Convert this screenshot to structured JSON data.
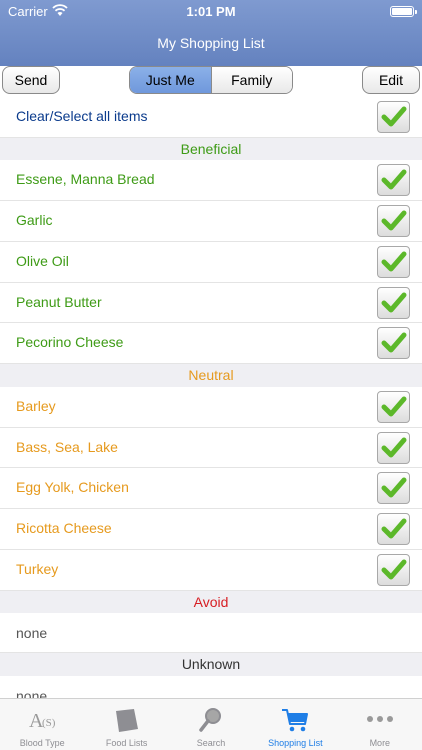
{
  "status": {
    "carrier": "Carrier",
    "time": "1:01 PM"
  },
  "nav": {
    "title": "My Shopping List"
  },
  "toolbar": {
    "send_label": "Send",
    "edit_label": "Edit",
    "seg_just_me": "Just Me",
    "seg_family": "Family"
  },
  "clear_row": {
    "label": "Clear/Select all items",
    "checked": true
  },
  "sections": {
    "beneficial": {
      "title": "Beneficial",
      "color": "#3e9b16",
      "items": [
        "Essene, Manna Bread",
        "Garlic",
        "Olive Oil",
        "Peanut Butter",
        "Pecorino Cheese"
      ]
    },
    "neutral": {
      "title": "Neutral",
      "color": "#e69a1e",
      "items": [
        "Barley",
        "Bass, Sea, Lake",
        "Egg Yolk, Chicken",
        "Ricotta Cheese",
        "Turkey"
      ]
    },
    "avoid": {
      "title": "Avoid",
      "color": "#d71e23",
      "empty_text": "none"
    },
    "unknown": {
      "title": "Unknown",
      "empty_text": "none"
    }
  },
  "tabs": [
    {
      "label": "Blood Type",
      "icon": "blood-type-icon"
    },
    {
      "label": "Food Lists",
      "icon": "food-lists-icon"
    },
    {
      "label": "Search",
      "icon": "search-icon"
    },
    {
      "label": "Shopping List",
      "icon": "cart-icon",
      "active": true
    },
    {
      "label": "More",
      "icon": "more-icon"
    }
  ],
  "colors": {
    "nav_bg": "#6b88c5",
    "active_tab": "#1f7ee6",
    "check_green": "#5cb82a"
  }
}
